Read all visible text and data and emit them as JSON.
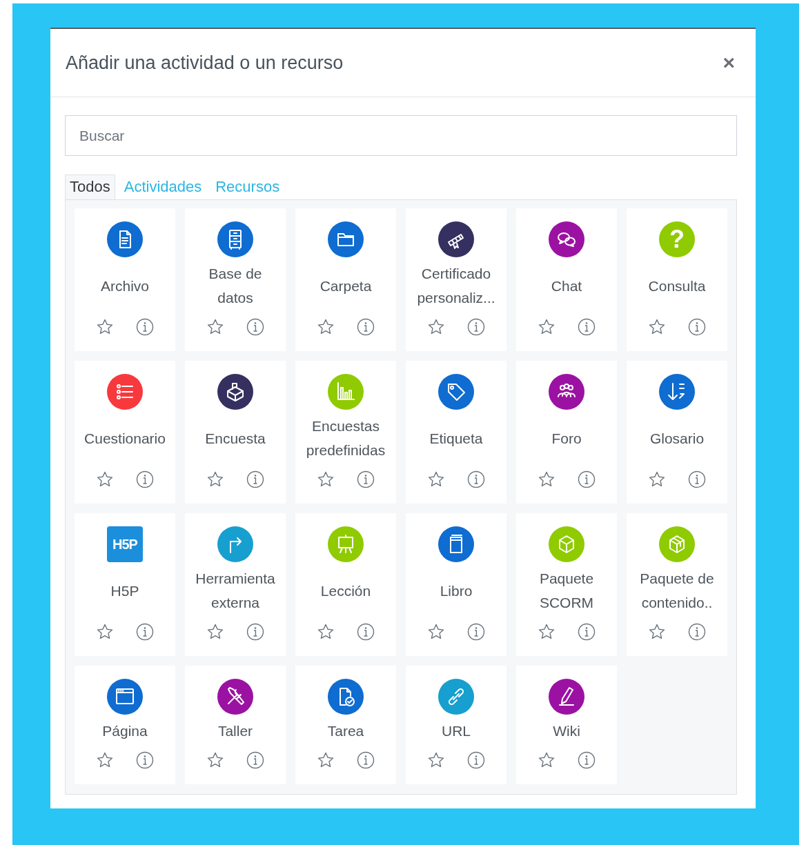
{
  "dialog": {
    "title": "Añadir una actividad o un recurso",
    "close": "×"
  },
  "search": {
    "placeholder": "Buscar"
  },
  "tabs": [
    {
      "label": "Todos",
      "selected": true
    },
    {
      "label": "Actividades",
      "selected": false
    },
    {
      "label": "Recursos",
      "selected": false
    }
  ],
  "items": [
    {
      "name": "Archivo",
      "kind": "icon",
      "color": "#0f6cd0"
    },
    {
      "name": "Base de datos",
      "kind": "icon",
      "color": "#0f6cd0"
    },
    {
      "name": "Carpeta",
      "kind": "icon",
      "color": "#0f6cd0"
    },
    {
      "name": "Certificado personaliz...",
      "kind": "icon",
      "color": "#35305f"
    },
    {
      "name": "Chat",
      "kind": "icon",
      "color": "#9b12a3"
    },
    {
      "name": "Consulta",
      "kind": "glyph",
      "glyph": "?",
      "color": "#8fcb00"
    },
    {
      "name": "Cuestionario",
      "kind": "icon",
      "color": "#f7393d"
    },
    {
      "name": "Encuesta",
      "kind": "icon",
      "color": "#35305f"
    },
    {
      "name": "Encuestas predefinidas",
      "kind": "icon",
      "color": "#8fcb00"
    },
    {
      "name": "Etiqueta",
      "kind": "icon",
      "color": "#0f6cd0"
    },
    {
      "name": "Foro",
      "kind": "icon",
      "color": "#9b12a3"
    },
    {
      "name": "Glosario",
      "kind": "icon",
      "color": "#0f6cd0"
    },
    {
      "name": "H5P",
      "kind": "logo",
      "glyph": "H5P",
      "color": "#1b8fdc"
    },
    {
      "name": "Herramienta externa",
      "kind": "icon",
      "color": "#179fcf"
    },
    {
      "name": "Lección",
      "kind": "icon",
      "color": "#8fcb00"
    },
    {
      "name": "Libro",
      "kind": "icon",
      "color": "#0f6cd0"
    },
    {
      "name": "Paquete SCORM",
      "kind": "icon",
      "color": "#8fcb00"
    },
    {
      "name": "Paquete de contenido..",
      "kind": "icon",
      "color": "#8fcb00"
    },
    {
      "name": "Página",
      "kind": "icon",
      "color": "#0f6cd0"
    },
    {
      "name": "Taller",
      "kind": "icon",
      "color": "#9b12a3"
    },
    {
      "name": "Tarea",
      "kind": "icon",
      "color": "#0f6cd0"
    },
    {
      "name": "URL",
      "kind": "icon",
      "color": "#179fcf"
    },
    {
      "name": "Wiki",
      "kind": "icon",
      "color": "#9b12a3"
    }
  ]
}
